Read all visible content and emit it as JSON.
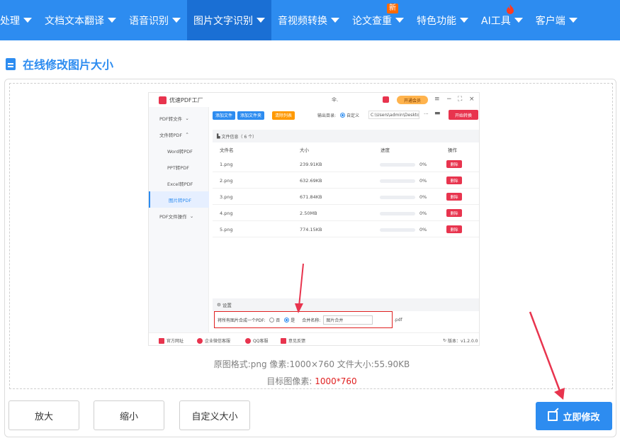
{
  "nav": {
    "items": [
      {
        "label": "处理",
        "active": false
      },
      {
        "label": "文档文本翻译",
        "active": false
      },
      {
        "label": "语音识别",
        "active": false
      },
      {
        "label": "图片文字识别",
        "active": true
      },
      {
        "label": "音视频转换",
        "active": false
      },
      {
        "label": "论文查重",
        "active": false,
        "badge": "新"
      },
      {
        "label": "特色功能",
        "active": false
      },
      {
        "label": "AI工具",
        "active": false,
        "icon": "fire-icon"
      },
      {
        "label": "客户端",
        "active": false
      }
    ],
    "colors": {
      "bg": "#2d8cf0",
      "active_bg": "#1a6fd4",
      "badge": "#ff6a00"
    }
  },
  "section": {
    "title": "在线修改图片大小"
  },
  "preview": {
    "app": {
      "name": "优速PDF工厂",
      "user": "伞.",
      "vip": "开通会员",
      "sidebar": [
        {
          "label": "PDF转文件",
          "chevron": "⌄"
        },
        {
          "label": "文件转PDF",
          "chevron": "⌃"
        },
        {
          "label": "Word转PDF"
        },
        {
          "label": "PPT转PDF"
        },
        {
          "label": "Excel转PDF"
        },
        {
          "label": "图片转PDF",
          "selected": true
        },
        {
          "label": "PDF文件操作",
          "chevron": "⌄"
        }
      ],
      "toolbar": {
        "add_file": "添加文件",
        "add_folder": "添加文件夹",
        "clear": "清除列表",
        "output_label": "输出目录:",
        "custom": "自定义",
        "path": "C:\\Users\\admin\\Deskto",
        "more": "···",
        "start": "开始转换"
      },
      "file_info": "文件信息（ 6 个）",
      "columns": [
        "文件名",
        "大小",
        "进度",
        "操作"
      ],
      "rows": [
        {
          "name": "1.png",
          "size": "239.91KB",
          "progress": "0%",
          "action": "删除"
        },
        {
          "name": "2.png",
          "size": "632.69KB",
          "progress": "0%",
          "action": "删除"
        },
        {
          "name": "3.png",
          "size": "671.84KB",
          "progress": "0%",
          "action": "删除"
        },
        {
          "name": "4.png",
          "size": "2.50MB",
          "progress": "0%",
          "action": "删除"
        },
        {
          "name": "5.png",
          "size": "774.15KB",
          "progress": "0%",
          "action": "删除"
        }
      ],
      "settings": "设置",
      "merge": {
        "label": "将所有图片合成一个PDF:",
        "no": "否",
        "yes": "是",
        "name_label": "合并名称:",
        "name_value": "图片合并",
        "ext": ".pdf"
      },
      "footer": {
        "site": "官方网址",
        "wechat": "企业微信客服",
        "qq": "QQ客服",
        "feedback": "意见反馈",
        "version": "版本：v1.2.0.0"
      }
    }
  },
  "info": {
    "line1": "原图格式:png 像素:1000×760 文件大小:55.90KB",
    "line2_label": "目标图像素:",
    "line2_value": "1000*760"
  },
  "buttons": {
    "zoom_in": "放大",
    "zoom_out": "缩小",
    "custom_size": "自定义大小",
    "submit": "立即修改"
  }
}
